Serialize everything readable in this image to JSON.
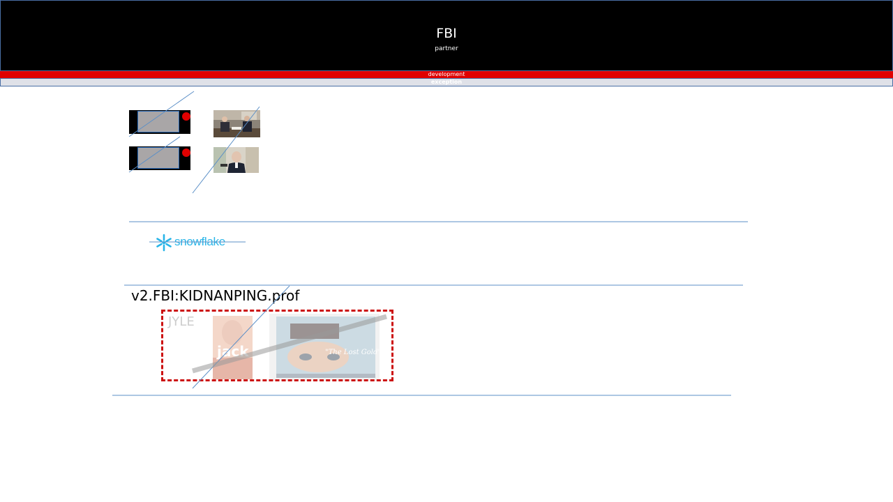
{
  "header": {
    "title": "FBI",
    "subtitle": "partner",
    "band_label": "development",
    "subband_label": "exception"
  },
  "logo": {
    "text": "snowflake",
    "icon": "snowflake-icon"
  },
  "profile": {
    "title": "v2.FBI:KIDNANPING.prof",
    "faded_label": "JYLE",
    "cover_title": "jack",
    "album_title": "\"The Lost Gold\""
  },
  "colors": {
    "header_bg": "#000000",
    "accent_red": "#e00000",
    "band_grey": "#dfe1e8",
    "logo_blue": "#29b5e8",
    "line_blue": "#5b8fc7",
    "dashed_box": "#cc1111"
  }
}
